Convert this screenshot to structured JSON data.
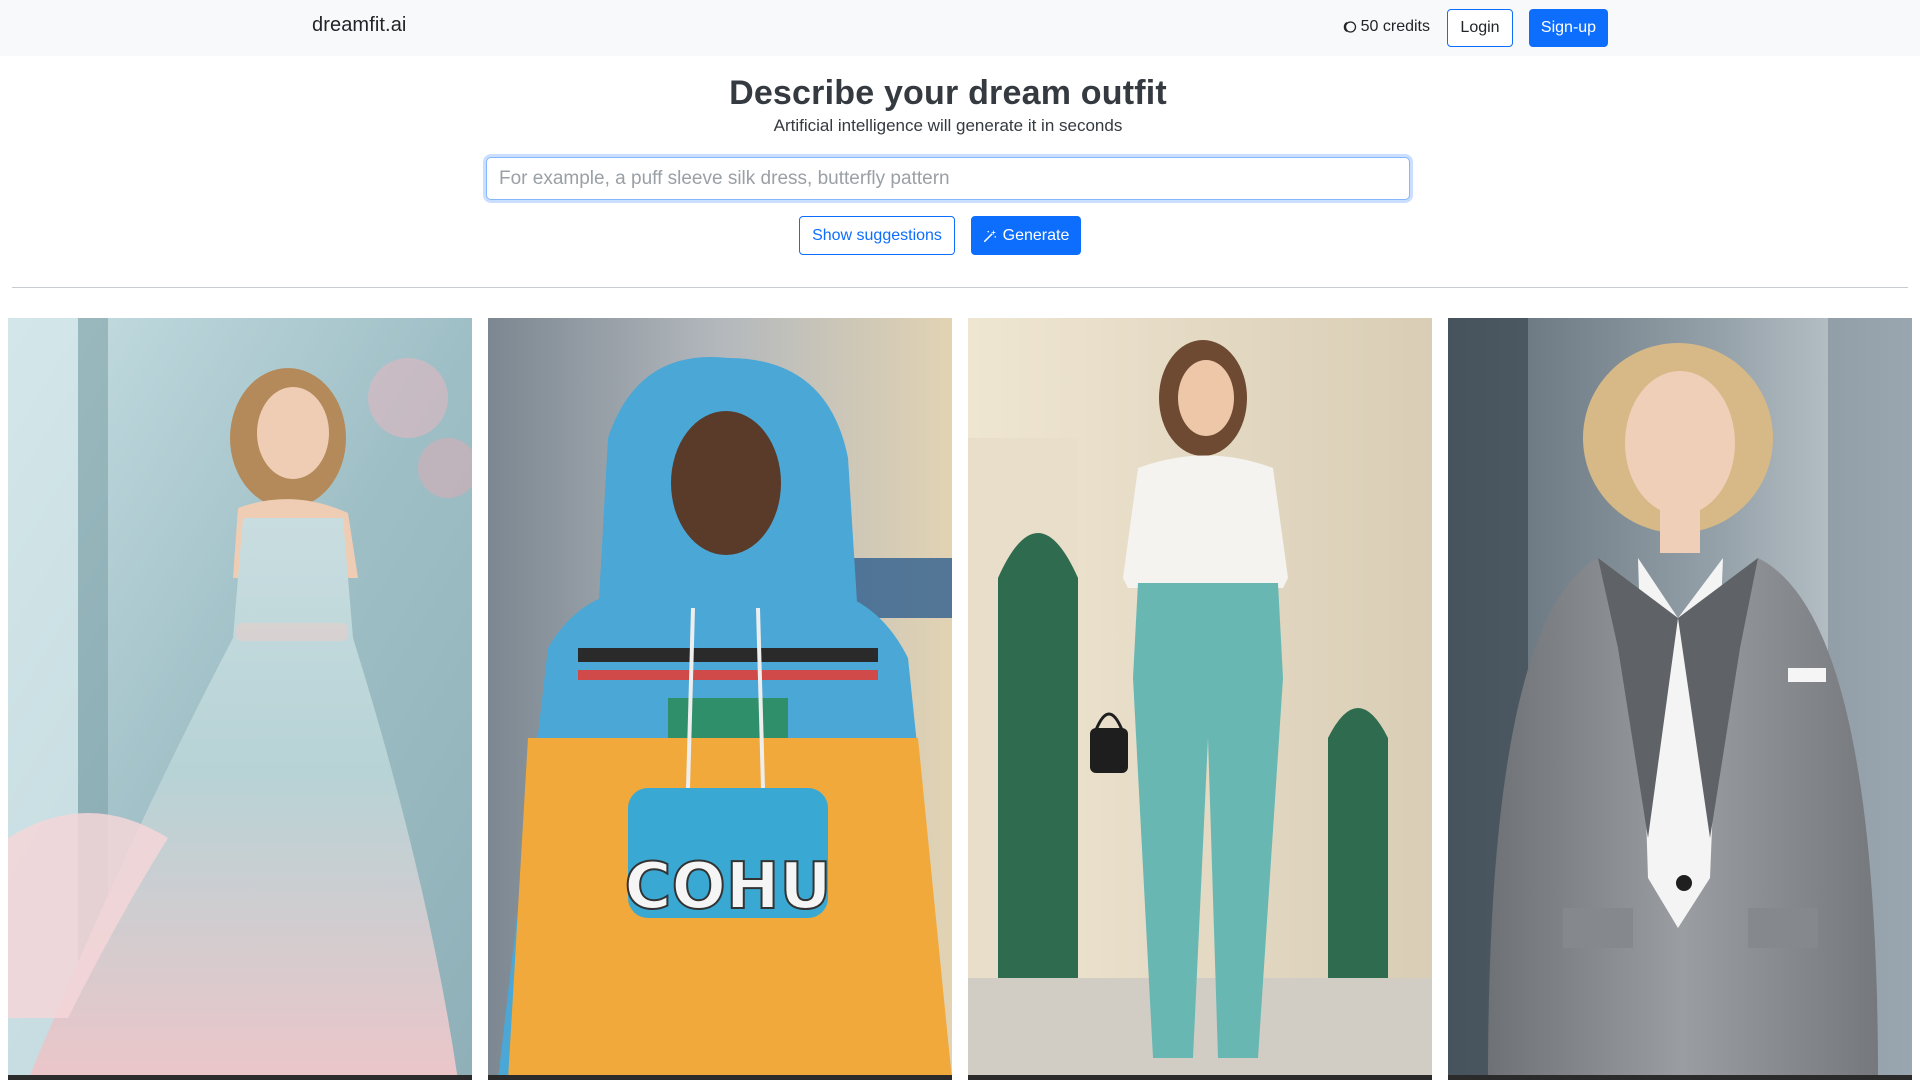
{
  "navbar": {
    "brand": "dreamfit.ai",
    "credits_text": "50 credits",
    "credits_icon": "coins-icon",
    "login_label": "Login",
    "signup_label": "Sign-up"
  },
  "hero": {
    "title": "Describe your dream outfit",
    "subtitle": "Artificial intelligence will generate it in seconds",
    "input_placeholder": "For example, a puff sleeve silk dress, butterfly pattern",
    "input_value": "",
    "suggest_label": "Show suggestions",
    "generate_label": "Generate",
    "generate_icon": "magic-wand-icon"
  },
  "colors": {
    "primary": "#0d6efd",
    "navbar_bg": "#f8f9fa",
    "heading": "#343a40"
  },
  "gallery": {
    "items": [
      {
        "outfit": "pastel chiffon gown",
        "bg": "#a9c6cc",
        "garment": "#e8c4c8",
        "accent": "#b9d8dc"
      },
      {
        "outfit": "printed oversized hoodie",
        "bg": "#9aa3ab",
        "garment": "#f2a93b",
        "accent": "#4fa8d6"
      },
      {
        "outfit": "white blouse and teal trousers",
        "bg": "#e8dcc6",
        "garment": "#69b7b3",
        "accent": "#f2f2ef"
      },
      {
        "outfit": "grey tailored blazer",
        "bg": "#7e8a94",
        "garment": "#8b8e92",
        "accent": "#f3f3f3"
      }
    ]
  }
}
